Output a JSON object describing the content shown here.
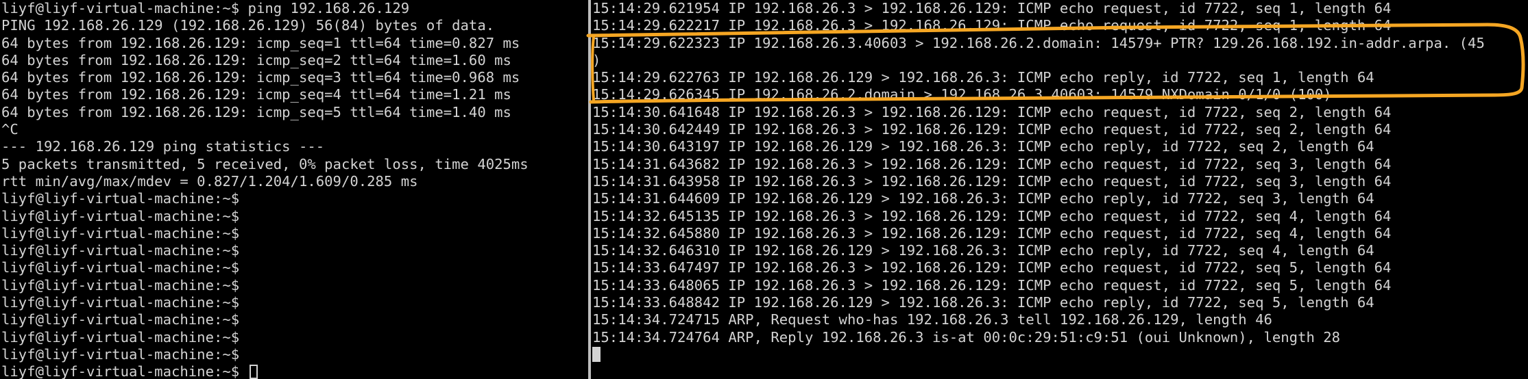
{
  "colors": {
    "background": "#000000",
    "text": "#d3d3d3",
    "divider": "#bdbdbd",
    "annotation": "#f5a623"
  },
  "left_terminal": {
    "lines": [
      "liyf@liyf-virtual-machine:~$ ping 192.168.26.129",
      "PING 192.168.26.129 (192.168.26.129) 56(84) bytes of data.",
      "64 bytes from 192.168.26.129: icmp_seq=1 ttl=64 time=0.827 ms",
      "64 bytes from 192.168.26.129: icmp_seq=2 ttl=64 time=1.60 ms",
      "64 bytes from 192.168.26.129: icmp_seq=3 ttl=64 time=0.968 ms",
      "64 bytes from 192.168.26.129: icmp_seq=4 ttl=64 time=1.21 ms",
      "64 bytes from 192.168.26.129: icmp_seq=5 ttl=64 time=1.40 ms",
      "^C",
      "--- 192.168.26.129 ping statistics ---",
      "5 packets transmitted, 5 received, 0% packet loss, time 4025ms",
      "rtt min/avg/max/mdev = 0.827/1.204/1.609/0.285 ms",
      "liyf@liyf-virtual-machine:~$",
      "liyf@liyf-virtual-machine:~$",
      "liyf@liyf-virtual-machine:~$",
      "liyf@liyf-virtual-machine:~$",
      "liyf@liyf-virtual-machine:~$",
      "liyf@liyf-virtual-machine:~$",
      "liyf@liyf-virtual-machine:~$",
      "liyf@liyf-virtual-machine:~$",
      "liyf@liyf-virtual-machine:~$",
      "liyf@liyf-virtual-machine:~$"
    ],
    "prompt": "liyf@liyf-virtual-machine:~$ "
  },
  "right_terminal": {
    "lines": [
      "15:14:29.621954 IP 192.168.26.3 > 192.168.26.129: ICMP echo request, id 7722, seq 1, length 64",
      "15:14:29.622217 IP 192.168.26.3 > 192.168.26.129: ICMP echo request, id 7722, seq 1, length 64",
      "15:14:29.622323 IP 192.168.26.3.40603 > 192.168.26.2.domain: 14579+ PTR? 129.26.168.192.in-addr.arpa. (45",
      ")",
      "15:14:29.622763 IP 192.168.26.129 > 192.168.26.3: ICMP echo reply, id 7722, seq 1, length 64",
      "15:14:29.626345 IP 192.168.26.2.domain > 192.168.26.3.40603: 14579 NXDomain 0/1/0 (100)",
      "15:14:30.641648 IP 192.168.26.3 > 192.168.26.129: ICMP echo request, id 7722, seq 2, length 64",
      "15:14:30.642449 IP 192.168.26.3 > 192.168.26.129: ICMP echo request, id 7722, seq 2, length 64",
      "15:14:30.643197 IP 192.168.26.129 > 192.168.26.3: ICMP echo reply, id 7722, seq 2, length 64",
      "15:14:31.643682 IP 192.168.26.3 > 192.168.26.129: ICMP echo request, id 7722, seq 3, length 64",
      "15:14:31.643958 IP 192.168.26.3 > 192.168.26.129: ICMP echo request, id 7722, seq 3, length 64",
      "15:14:31.644609 IP 192.168.26.129 > 192.168.26.3: ICMP echo reply, id 7722, seq 3, length 64",
      "15:14:32.645135 IP 192.168.26.3 > 192.168.26.129: ICMP echo request, id 7722, seq 4, length 64",
      "15:14:32.645880 IP 192.168.26.3 > 192.168.26.129: ICMP echo request, id 7722, seq 4, length 64",
      "15:14:32.646310 IP 192.168.26.129 > 192.168.26.3: ICMP echo reply, id 7722, seq 4, length 64",
      "15:14:33.647497 IP 192.168.26.3 > 192.168.26.129: ICMP echo request, id 7722, seq 5, length 64",
      "15:14:33.648065 IP 192.168.26.3 > 192.168.26.129: ICMP echo request, id 7722, seq 5, length 64",
      "15:14:33.648842 IP 192.168.26.129 > 192.168.26.3: ICMP echo reply, id 7722, seq 5, length 64",
      "15:14:34.724715 ARP, Request who-has 192.168.26.3 tell 192.168.26.129, length 46",
      "15:14:34.724764 ARP, Reply 192.168.26.3 is-at 00:0c:29:51:c9:51 (oui Unknown), length 28"
    ]
  }
}
